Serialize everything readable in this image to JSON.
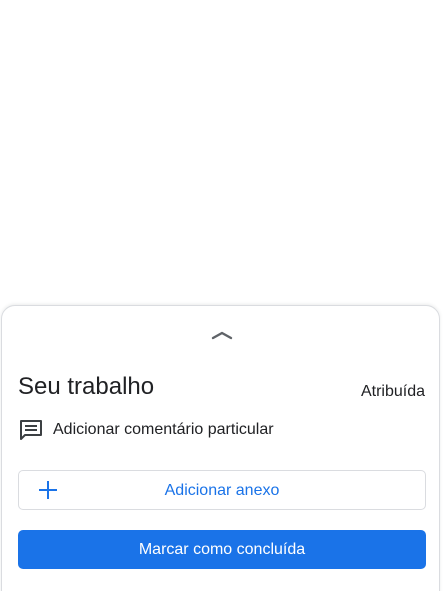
{
  "sheet": {
    "title": "Seu trabalho",
    "status": "Atribuída",
    "comment": {
      "label": "Adicionar comentário particular",
      "icon": "comment-icon"
    },
    "attach_button": {
      "label": "Adicionar anexo",
      "icon": "plus-icon"
    },
    "done_button": {
      "label": "Marcar como concluída"
    },
    "handle_icon": "chevron-up-icon"
  },
  "colors": {
    "accent": "#1a73e8",
    "text": "#202124",
    "border": "#dadce0",
    "icon": "#3c4043"
  }
}
